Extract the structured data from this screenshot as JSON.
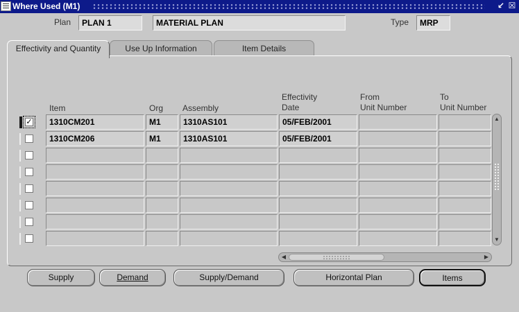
{
  "window": {
    "title": "Where Used (M1)",
    "controls": [
      "↙",
      "☒"
    ]
  },
  "header": {
    "plan_label": "Plan",
    "plan_value": "PLAN 1",
    "plan_desc": "MATERIAL PLAN",
    "type_label": "Type",
    "type_value": "MRP"
  },
  "tabs": [
    {
      "label": "Effectivity and Quantity",
      "active": true
    },
    {
      "label": "Use Up Information",
      "active": false
    },
    {
      "label": "Item Details",
      "active": false
    }
  ],
  "columns": {
    "item": "Item",
    "org": "Org",
    "assembly": "Assembly",
    "eff_date_1": "Effectivity",
    "eff_date_2": "Date",
    "from_unit_1": "From",
    "from_unit_2": "Unit Number",
    "to_unit_1": "To",
    "to_unit_2": "Unit Number"
  },
  "rows": [
    {
      "item": "1310CM201",
      "org": "M1",
      "assembly": "1310AS101",
      "eff_date": "05/FEB/2001",
      "from_unit": "",
      "to_unit": "",
      "check": "✓"
    },
    {
      "item": "1310CM206",
      "org": "M1",
      "assembly": "1310AS101",
      "eff_date": "05/FEB/2001",
      "from_unit": "",
      "to_unit": "",
      "check": ""
    },
    {
      "item": "",
      "org": "",
      "assembly": "",
      "eff_date": "",
      "from_unit": "",
      "to_unit": "",
      "check": ""
    },
    {
      "item": "",
      "org": "",
      "assembly": "",
      "eff_date": "",
      "from_unit": "",
      "to_unit": "",
      "check": ""
    },
    {
      "item": "",
      "org": "",
      "assembly": "",
      "eff_date": "",
      "from_unit": "",
      "to_unit": "",
      "check": ""
    },
    {
      "item": "",
      "org": "",
      "assembly": "",
      "eff_date": "",
      "from_unit": "",
      "to_unit": "",
      "check": ""
    },
    {
      "item": "",
      "org": "",
      "assembly": "",
      "eff_date": "",
      "from_unit": "",
      "to_unit": "",
      "check": ""
    },
    {
      "item": "",
      "org": "",
      "assembly": "",
      "eff_date": "",
      "from_unit": "",
      "to_unit": "",
      "check": ""
    }
  ],
  "scroll_arrows": {
    "up": "▲",
    "down": "▼",
    "left": "◀",
    "right": "▶"
  },
  "buttons": {
    "supply": "Supply",
    "demand": "Demand",
    "supply_demand": "Supply/Demand",
    "horizontal_plan": "Horizontal Plan",
    "items": "Items"
  },
  "colors": {
    "titlebar": "#0d1a8a",
    "background": "#c8c8c8"
  }
}
